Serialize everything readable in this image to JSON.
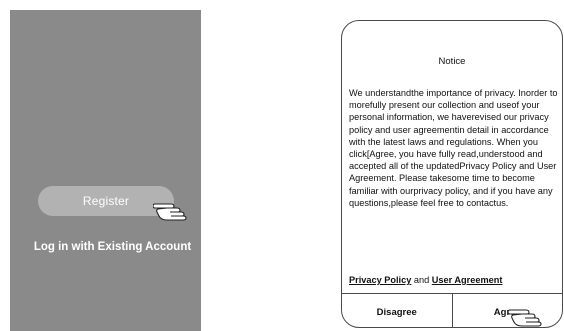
{
  "left_screen": {
    "register_label": "Register",
    "login_label": "Log in with Existing Account"
  },
  "dialog": {
    "title": "Notice",
    "body": "We understandthe importance of privacy. Inorder to morefully present our collection and useof your personal information, we haverevised our privacy policy and user agreementin detail in accordance with the latest laws and regulations. When you click[Agree, you have fully read,understood and accepted all of the updatedPrivacy Policy and User Agreement. Please takesome time to become familiar with ourprivacy policy, and if you have any questions,please feel free to contactus.",
    "privacy_policy_link": "Privacy Policy",
    "and_text": "and",
    "user_agreement_link": "User Agreement",
    "disagree_label": "Disagree",
    "agree_label": "Agree"
  },
  "icons": {
    "pointer": "pointing-hand-icon"
  },
  "colors": {
    "screen_bg": "#8a8a8a",
    "register_bg": "#b2b2b2",
    "dialog_border": "#4a4a4a"
  }
}
